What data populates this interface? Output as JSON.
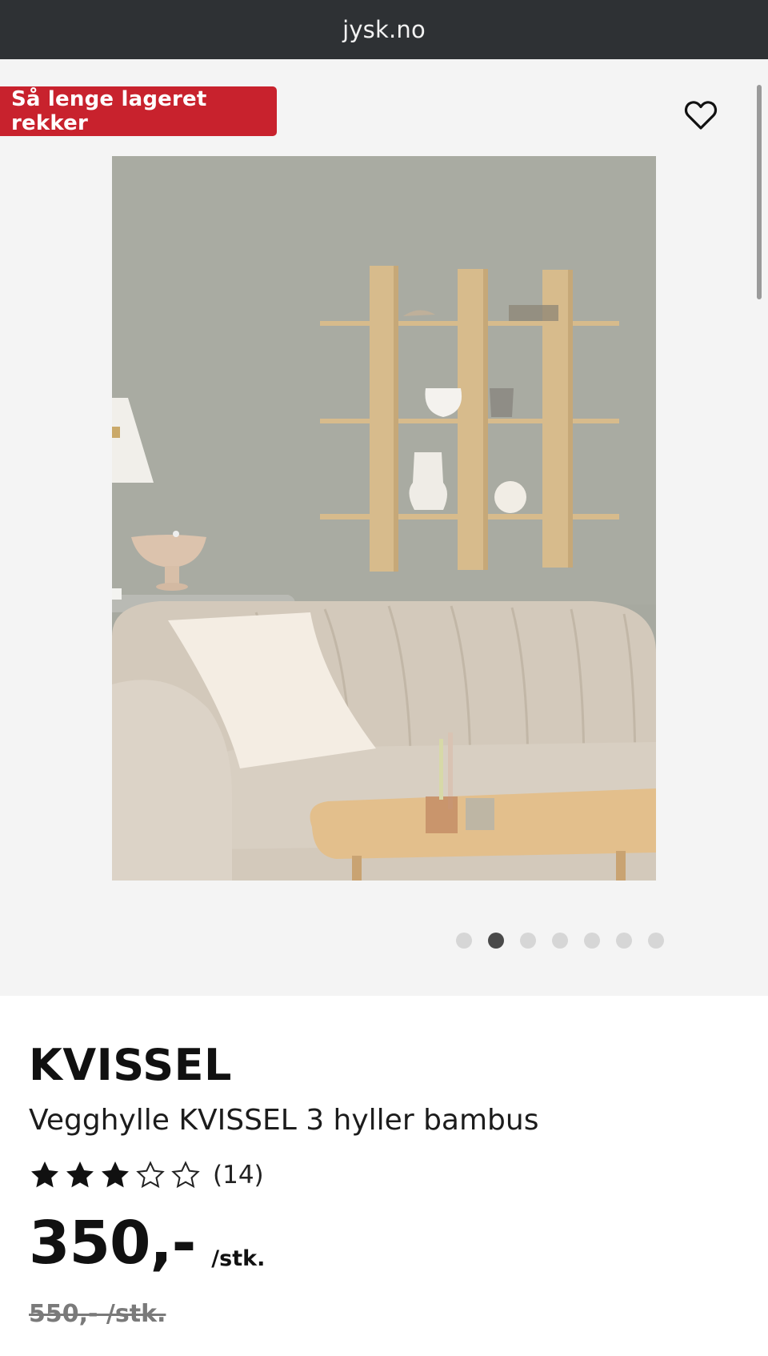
{
  "browser": {
    "url": "jysk.no"
  },
  "badge": {
    "label": "Så lenge lageret rekker",
    "color": "#c8222d"
  },
  "favorite": {
    "icon": "heart-outline-icon"
  },
  "gallery": {
    "image_count": 7,
    "active_index": 1
  },
  "product": {
    "brand": "KVISSEL",
    "name": "Vegghylle KVISSEL 3 hyller bambus",
    "rating": {
      "stars_filled": 3,
      "stars_total": 5,
      "count_label": "(14)"
    },
    "price": {
      "current": "350,-",
      "unit": "/stk.",
      "old": "550,- /stk."
    }
  }
}
